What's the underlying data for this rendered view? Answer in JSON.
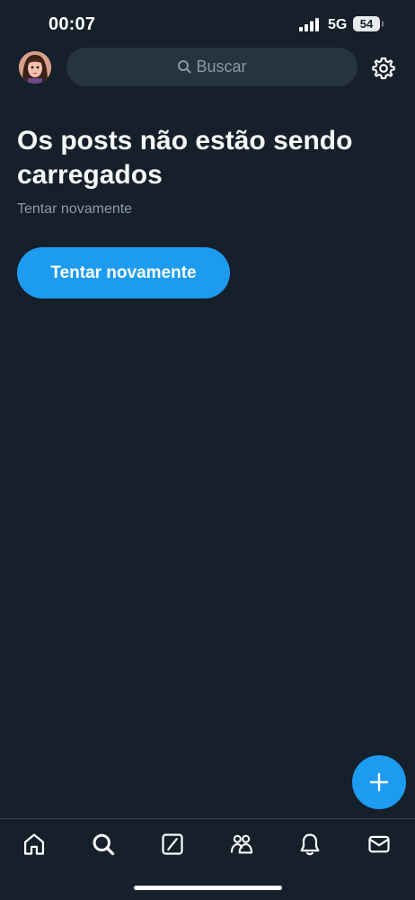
{
  "status_bar": {
    "time": "00:07",
    "network": "5G",
    "battery": "54"
  },
  "header": {
    "search_placeholder": "Buscar",
    "avatar_icon": "profile-avatar",
    "settings_icon": "gear-icon"
  },
  "main": {
    "title": "Os posts não estão sendo carregados",
    "subtitle": "Tentar novamente",
    "retry_button": "Tentar novamente"
  },
  "fab": {
    "icon": "plus-icon"
  },
  "bottom_nav": {
    "items": [
      "home-icon",
      "search-icon",
      "grok-icon",
      "communities-icon",
      "notifications-icon",
      "messages-icon"
    ]
  },
  "colors": {
    "background": "#15202b",
    "accent": "#1d9bf0",
    "search_bg": "#273340",
    "secondary_text": "#8b98a5",
    "divider": "#38444d"
  }
}
